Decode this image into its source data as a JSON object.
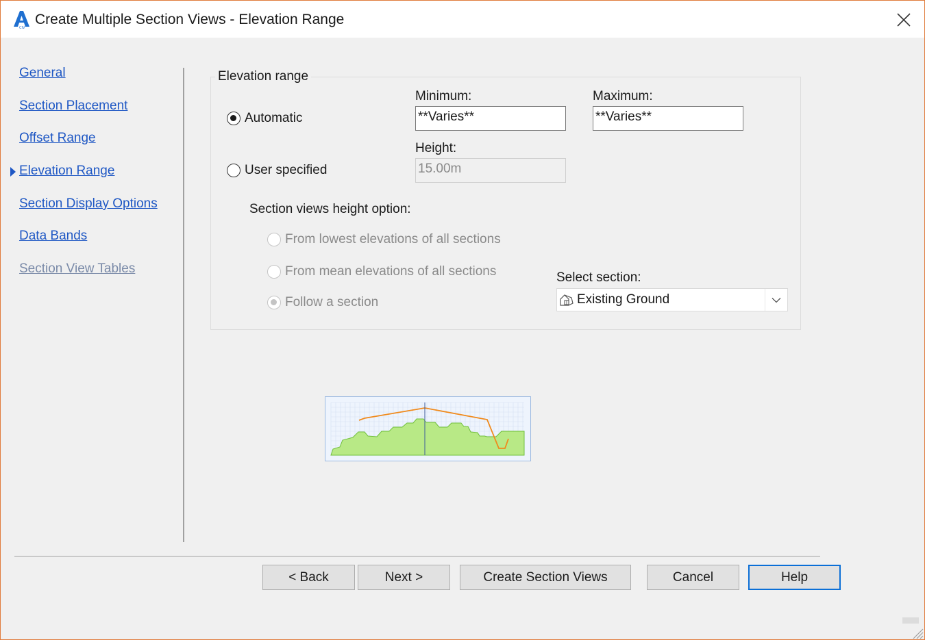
{
  "window": {
    "title": "Create Multiple Section Views - Elevation Range",
    "accent_color": "#e07a3a",
    "app_icon": "autocad-civil-icon",
    "close_icon": "close-icon"
  },
  "nav": {
    "items": [
      {
        "label": "General",
        "enabled": true,
        "active": false
      },
      {
        "label": "Section Placement",
        "enabled": true,
        "active": false
      },
      {
        "label": "Offset Range",
        "enabled": true,
        "active": false
      },
      {
        "label": "Elevation Range",
        "enabled": true,
        "active": true
      },
      {
        "label": "Section Display Options",
        "enabled": true,
        "active": false
      },
      {
        "label": "Data Bands",
        "enabled": true,
        "active": false
      },
      {
        "label": "Section View Tables",
        "enabled": false,
        "active": false
      }
    ],
    "link_color": "#1e57c4"
  },
  "elevation": {
    "group_title": "Elevation range",
    "automatic_label": "Automatic",
    "automatic_selected": true,
    "user_specified_label": "User specified",
    "user_specified_selected": false,
    "minimum_label": "Minimum:",
    "minimum_value": "**Varies**",
    "maximum_label": "Maximum:",
    "maximum_value": "**Varies**",
    "height_label": "Height:",
    "height_value": "15.00m",
    "height_option_label": "Section views height option:",
    "options": [
      {
        "label": "From lowest elevations of all sections",
        "selected": false
      },
      {
        "label": "From mean elevations of all sections",
        "selected": false
      },
      {
        "label": "Follow a section",
        "selected": true
      }
    ],
    "select_section_label": "Select section:",
    "select_section_value": "Existing Ground",
    "select_section_icon": "surface-icon"
  },
  "preview": {
    "ground_fill": "#b8e986",
    "line_color": "#f08a1c"
  },
  "buttons": {
    "back": "< Back",
    "next": "Next >",
    "create": "Create Section Views",
    "cancel": "Cancel",
    "help": "Help"
  }
}
